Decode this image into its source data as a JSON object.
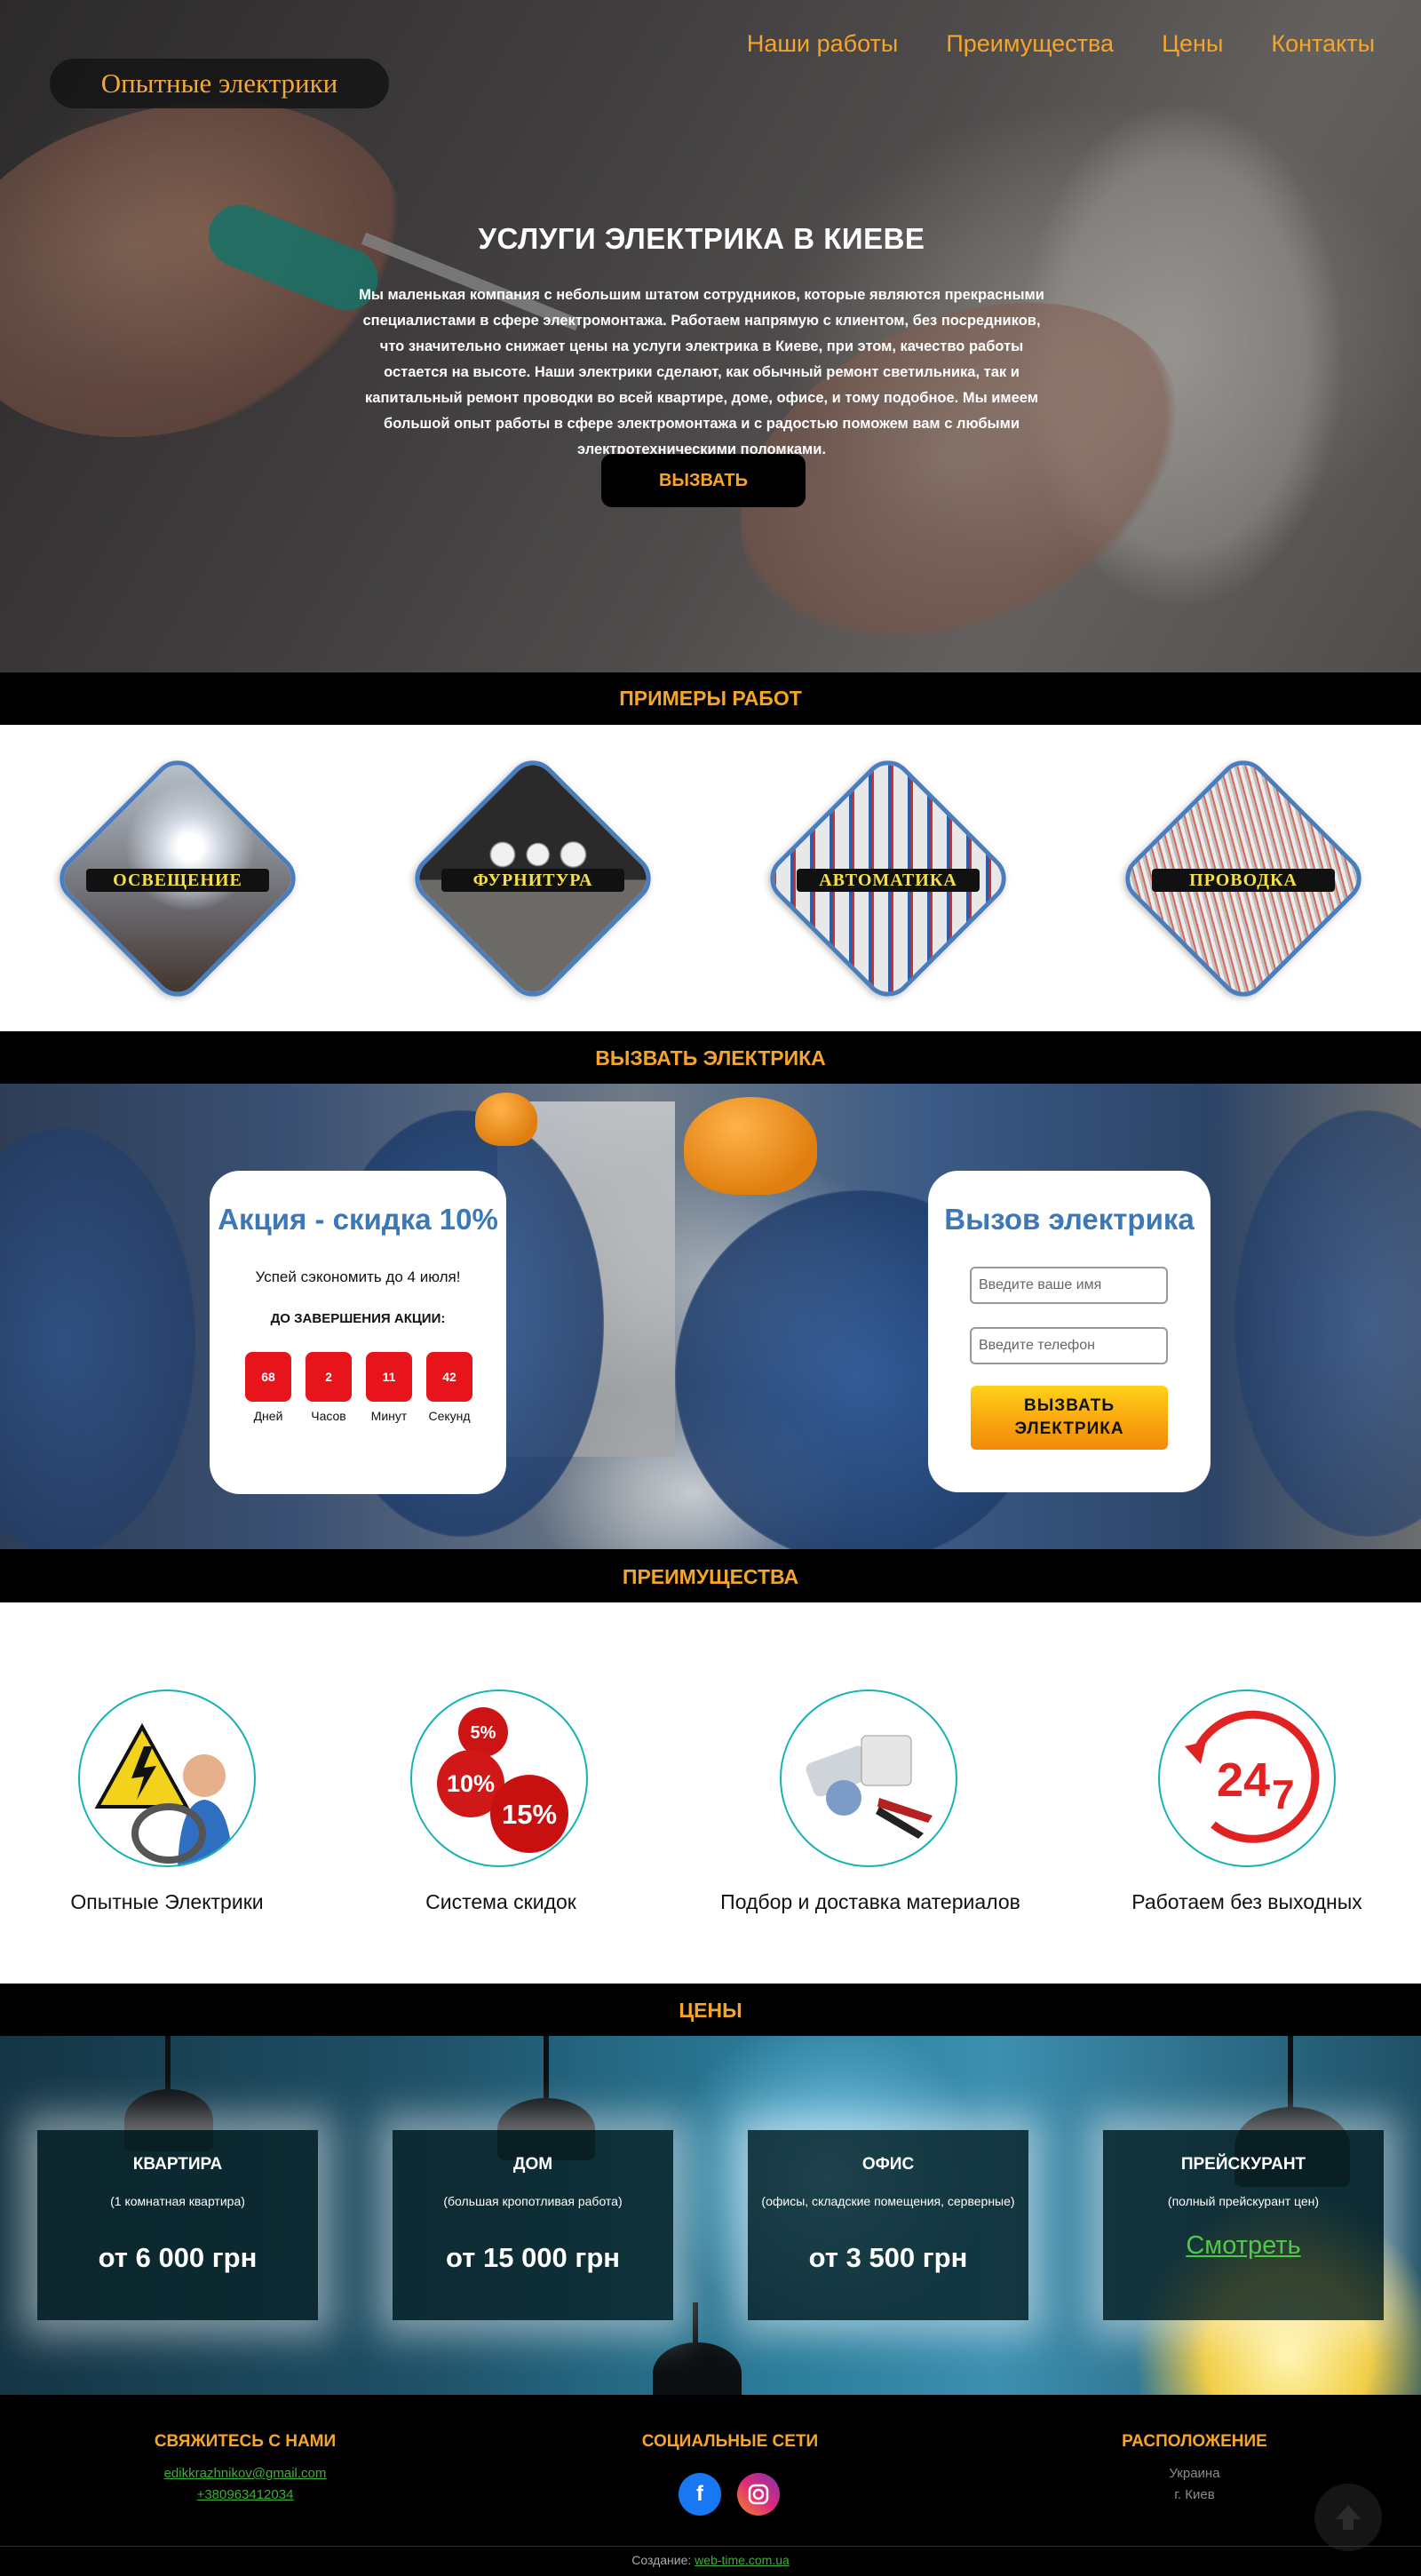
{
  "brand": {
    "logo": "Опытные электрики"
  },
  "nav": [
    "Наши работы",
    "Преимущества",
    "Цены",
    "Контакты"
  ],
  "hero": {
    "title": "УСЛУГИ ЭЛЕКТРИКА В КИЕВЕ",
    "text": "Мы маленькая компания с небольшим штатом сотрудников, которые являются прекрасными специалистами в сфере электромонтажа. Работаем напрямую с клиентом, без посредников, что значительно снижает цены на услуги электрика в Киеве, при этом, качество работы остается на высоте. Наши электрики сделают, как обычный ремонт светильника, так и капитальный ремонт проводки во всей квартире, доме, офисе, и тому подобное. Мы имеем большой опыт работы в сфере электромонтажа и с радостью поможем вам с любыми электротехническими поломками.",
    "button": "ВЫЗВАТЬ"
  },
  "works": {
    "heading": "ПРИМЕРЫ РАБОТ",
    "items": [
      "ОСВЕЩЕНИЕ",
      "ФУРНИТУРА",
      "АВТОМАТИКА",
      "ПРОВОДКА"
    ]
  },
  "call": {
    "heading": "ВЫЗВАТЬ ЭЛЕКТРИКА",
    "promo": {
      "title": "Акция - скидка 10%",
      "subtitle": "Успей сэкономить до 4 июля!",
      "until": "ДО ЗАВЕРШЕНИЯ АКЦИИ:",
      "countdown": [
        {
          "value": "68",
          "label": "Дней"
        },
        {
          "value": "2",
          "label": "Часов"
        },
        {
          "value": "11",
          "label": "Минут"
        },
        {
          "value": "42",
          "label": "Секунд"
        }
      ]
    },
    "form": {
      "title": "Вызов электрика",
      "name_placeholder": "Введите ваше имя",
      "phone_placeholder": "Введите телефон",
      "button_line1": "ВЫЗВАТЬ",
      "button_line2": "ЭЛЕКТРИКА"
    }
  },
  "advantages": {
    "heading": "ПРЕИМУЩЕСТВА",
    "items": [
      "Опытные Электрики",
      "Система скидок",
      "Подбор и доставка материалов",
      "Работаем без выходных"
    ],
    "discount_badges": [
      "5%",
      "10%",
      "15%"
    ],
    "clock_text": "24",
    "clock_small": "7"
  },
  "prices": {
    "heading": "ЦЕНЫ",
    "cards": [
      {
        "title": "КВАРТИРА",
        "subtitle": "(1 комнатная квартира)",
        "price": "от 6 000 грн"
      },
      {
        "title": "ДОМ",
        "subtitle": "(большая кропотливая работа)",
        "price": "от 15 000 грн"
      },
      {
        "title": "ОФИС",
        "subtitle": "(офисы, складские помещения, серверные)",
        "price": "от 3 500 грн"
      },
      {
        "title": "ПРЕЙСКУРАНТ",
        "subtitle": "(полный прейскурант цен)",
        "link": "Смотреть"
      }
    ]
  },
  "footer": {
    "contact_heading": "СВЯЖИТЕСЬ С НАМИ",
    "email": "edikkrazhnikov@gmail.com",
    "phone": "+380963412034",
    "social_heading": "СОЦИАЛЬНЫЕ СЕТИ",
    "location_heading": "РАСПОЛОЖЕНИЕ",
    "country": "Украина",
    "city": "г. Киев",
    "credit_label": "Создание:",
    "credit_link": "web-time.com.ua"
  },
  "colors": {
    "accent": "#f5a52a",
    "blue": "#3c78b8",
    "red": "#e8141c",
    "green": "#3fae3a",
    "teal": "#17b3b3"
  }
}
